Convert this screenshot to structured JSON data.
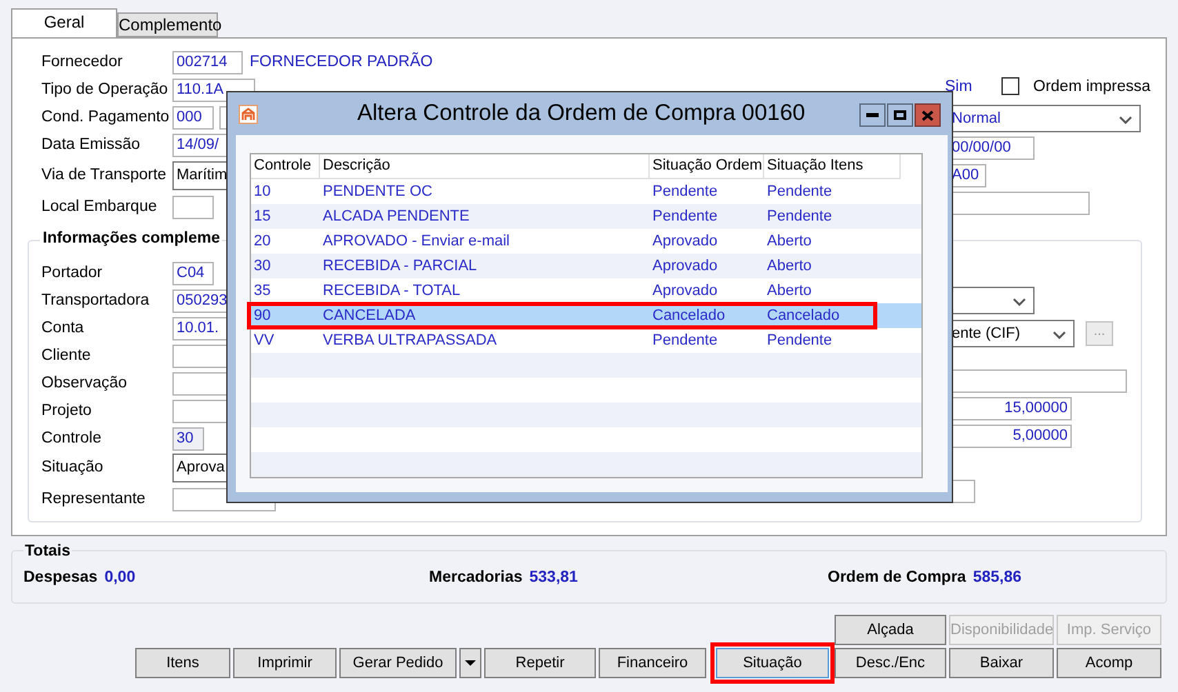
{
  "tabs": [
    {
      "label": "Geral",
      "selected": true
    },
    {
      "label": "Complemento",
      "selected": false
    }
  ],
  "header": {
    "rows": [
      {
        "label": "Fornecedor",
        "kind": "text",
        "value": "002714",
        "note": "FORNECEDOR PADRÃO"
      },
      {
        "label": "Tipo de Operação",
        "kind": "text",
        "value": "110.1A"
      },
      {
        "label": "Cond. Pagamento",
        "kind": "pair",
        "value": "000"
      },
      {
        "label": "Data Emissão",
        "kind": "text",
        "value": "14/09/"
      },
      {
        "label": "Via de Transporte",
        "kind": "select",
        "value": "Marítim"
      },
      {
        "label": "Local Embarque",
        "kind": "text"
      }
    ],
    "faturado": "Sim",
    "ordem_impressa": {
      "label": "Ordem impressa",
      "checked": false
    },
    "right_fields": [
      {
        "kind": "select",
        "value": "Normal"
      },
      {
        "kind": "text",
        "value": "00/00/00"
      },
      {
        "kind": "text",
        "value": "A00"
      },
      {
        "kind": "text"
      }
    ]
  },
  "info": {
    "title": "Informações compleme",
    "rows": [
      {
        "label": "Portador",
        "kind": "text",
        "value": "C04"
      },
      {
        "label": "Transportadora",
        "kind": "text",
        "value": "050293"
      },
      {
        "label": "Conta",
        "kind": "text",
        "value": "10.01."
      },
      {
        "label": "Cliente",
        "kind": "text"
      },
      {
        "label": "Observação",
        "kind": "text"
      },
      {
        "label": "Projeto",
        "kind": "text"
      },
      {
        "label": "Controle",
        "kind": "readonly",
        "value": "30"
      },
      {
        "label": "Situação",
        "kind": "select",
        "value": "Aprova"
      },
      {
        "label": "Representante",
        "kind": "text"
      }
    ],
    "right_fields": [
      {
        "kind": "select"
      },
      {
        "kind": "select-more",
        "value": "ente (CIF)",
        "button": "..."
      },
      {
        "kind": "text"
      },
      {
        "kind": "number",
        "value": "15,00000"
      },
      {
        "kind": "number",
        "value": "5,00000"
      },
      {
        "kind": "text"
      }
    ]
  },
  "totals": {
    "title": "Totais",
    "items": [
      {
        "label": "Despesas",
        "value": "0,00"
      },
      {
        "label": "Mercadorias",
        "value": "533,81"
      },
      {
        "label": "Ordem de Compra",
        "value": "585,86"
      }
    ]
  },
  "buttons": {
    "top": [
      {
        "label": "Alçada",
        "disabled": false
      },
      {
        "label": "Disponibilidade",
        "disabled": true
      },
      {
        "label": "Imp. Serviço",
        "disabled": true
      }
    ],
    "bottom": [
      {
        "kind": "button",
        "label": "Itens",
        "highlighted": false
      },
      {
        "kind": "button",
        "label": "Imprimir",
        "highlighted": false
      },
      {
        "kind": "button",
        "label": "Gerar Pedido",
        "highlighted": false
      },
      {
        "kind": "dropdown",
        "highlighted": false
      },
      {
        "kind": "button",
        "label": "Repetir",
        "highlighted": false
      },
      {
        "kind": "button",
        "label": "Financeiro",
        "highlighted": false
      },
      {
        "kind": "button",
        "label": "Situação",
        "highlighted": true
      },
      {
        "kind": "button",
        "label": "Desc./Enc",
        "highlighted": false
      },
      {
        "kind": "button",
        "label": "Baixar",
        "highlighted": false
      },
      {
        "kind": "button",
        "label": "Acomp",
        "highlighted": false
      }
    ]
  },
  "dialog": {
    "title": "Altera Controle da Ordem de Compra 00160",
    "columns": [
      "Controle",
      "Descrição",
      "Situação Ordem",
      "Situação Itens"
    ],
    "rows": [
      {
        "cells": [
          "10",
          "PENDENTE OC",
          "Pendente",
          "Pendente"
        ],
        "selected": false,
        "highlighted": false
      },
      {
        "cells": [
          "15",
          "ALCADA PENDENTE",
          "Pendente",
          "Pendente"
        ],
        "selected": false,
        "highlighted": false
      },
      {
        "cells": [
          "20",
          "APROVADO - Enviar e-mail",
          "Aprovado",
          "Aberto"
        ],
        "selected": false,
        "highlighted": false
      },
      {
        "cells": [
          "30",
          "RECEBIDA - PARCIAL",
          "Aprovado",
          "Aberto"
        ],
        "selected": false,
        "highlighted": false
      },
      {
        "cells": [
          "35",
          "RECEBIDA - TOTAL",
          "Aprovado",
          "Aberto"
        ],
        "selected": false,
        "highlighted": false
      },
      {
        "cells": [
          "90",
          "CANCELADA",
          "Cancelado",
          "Cancelado"
        ],
        "selected": true,
        "highlighted": true
      },
      {
        "cells": [
          "VV",
          "VERBA ULTRAPASSADA",
          "Pendente",
          "Pendente"
        ],
        "selected": false,
        "highlighted": false
      }
    ]
  }
}
